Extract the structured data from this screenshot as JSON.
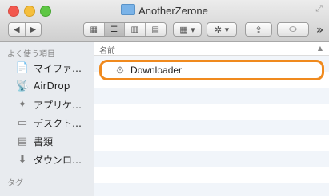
{
  "window": {
    "title": "AnotherZerone"
  },
  "toolbar": {
    "back_glyph": "◀",
    "forward_glyph": "▶",
    "views": [
      "▦",
      "☰",
      "▥",
      "▤"
    ],
    "arrange_glyph": "▦ ▾",
    "action_glyph": "✲ ▾",
    "share_glyph": "⇪",
    "tag_glyph": "⬭",
    "overflow": "»"
  },
  "sidebar": {
    "favorites_header": "よく使う項目",
    "items": [
      {
        "label": "マイファ…",
        "icon": "📄"
      },
      {
        "label": "AirDrop",
        "icon": "📡"
      },
      {
        "label": "アプリケ…",
        "icon": "✦"
      },
      {
        "label": "デスクト…",
        "icon": "▭"
      },
      {
        "label": "書類",
        "icon": "▤"
      },
      {
        "label": "ダウンロ…",
        "icon": "⬇"
      }
    ],
    "tags_header": "タグ"
  },
  "main": {
    "column_name": "名前",
    "files": [
      {
        "name": "Downloader",
        "icon": "⚙",
        "selected": true
      }
    ]
  },
  "colors": {
    "highlight": "#f08a1e"
  }
}
